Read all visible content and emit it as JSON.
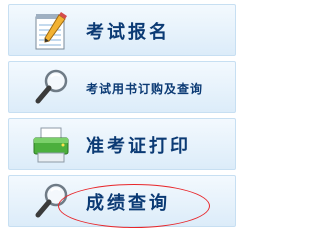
{
  "menu": {
    "items": [
      {
        "label": "考试报名",
        "icon": "notepad-pencil-icon"
      },
      {
        "label": "考试用书订购及查询",
        "icon": "magnifier-icon"
      },
      {
        "label": "准考证打印",
        "icon": "printer-icon"
      },
      {
        "label": "成绩查询",
        "icon": "magnifier-icon"
      }
    ],
    "highlight_color": "#e8262a",
    "label_color": "#0b3a74"
  }
}
